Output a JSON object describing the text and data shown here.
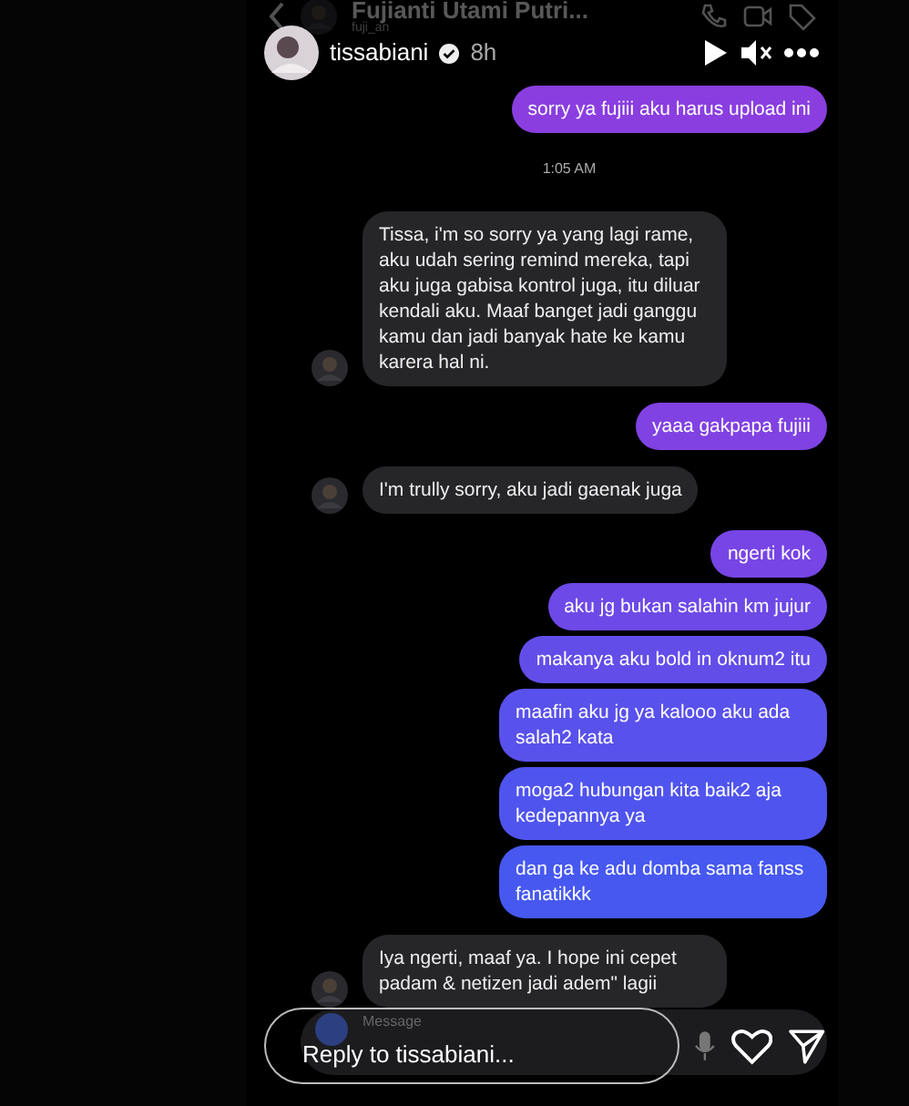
{
  "dm_header": {
    "name": "Fujianti Utami Putri...",
    "handle": "fuji_an"
  },
  "story": {
    "user": "tissabiani",
    "verified": true,
    "time": "8h"
  },
  "messages": [
    {
      "kind": "sent",
      "text": "sorry ya fujiii aku harus upload ini"
    },
    {
      "kind": "time",
      "text": "1:05 AM"
    },
    {
      "kind": "received",
      "text": "Tissa, i'm so sorry ya yang lagi rame, aku udah sering remind mereka, tapi aku juga gabisa kontrol juga, itu diluar kendali aku. Maaf banget jadi ganggu kamu dan jadi  banyak hate ke kamu karera hal ni.",
      "avatar": true
    },
    {
      "kind": "sent",
      "text": "yaaa gakpapa fujiii"
    },
    {
      "kind": "received",
      "text": "I'm trully sorry, aku jadi gaenak juga",
      "avatar": true
    },
    {
      "kind": "sent",
      "text": "ngerti kok"
    },
    {
      "kind": "sent",
      "text": "aku jg bukan salahin km jujur"
    },
    {
      "kind": "sent",
      "text": "makanya aku bold in oknum2 itu"
    },
    {
      "kind": "sent",
      "text": "maafin aku jg ya kalooo aku ada salah2 kata"
    },
    {
      "kind": "sent",
      "text": "moga2 hubungan kita baik2 aja kedepannya ya"
    },
    {
      "kind": "sent",
      "text": "dan ga ke adu domba sama fanss fanatikkk"
    },
    {
      "kind": "received",
      "text": "Iya ngerti, maaf ya. I hope ini cepet padam & netizen jadi adem\" lagii",
      "avatar": true
    }
  ],
  "dm_composer": {
    "placeholder": "Message"
  },
  "reply": {
    "placeholder": "Reply to tissabiani..."
  }
}
